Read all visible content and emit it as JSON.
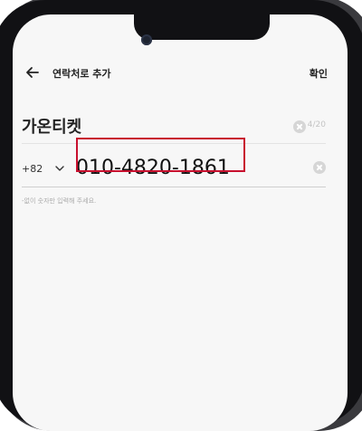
{
  "header": {
    "title": "연락처로 추가",
    "confirm_label": "확인"
  },
  "name_field": {
    "value": "가온티켓",
    "counter": "4/20"
  },
  "phone_field": {
    "country_code": "+82",
    "value": "010-4820-1861"
  },
  "helper_text": "-없이 숫자만 입력해 주세요.",
  "colors": {
    "highlight": "#c8102e",
    "background": "#f7f7f7"
  },
  "icons": {
    "back": "back-arrow-icon",
    "dropdown": "chevron-down-icon",
    "clear": "clear-icon"
  }
}
